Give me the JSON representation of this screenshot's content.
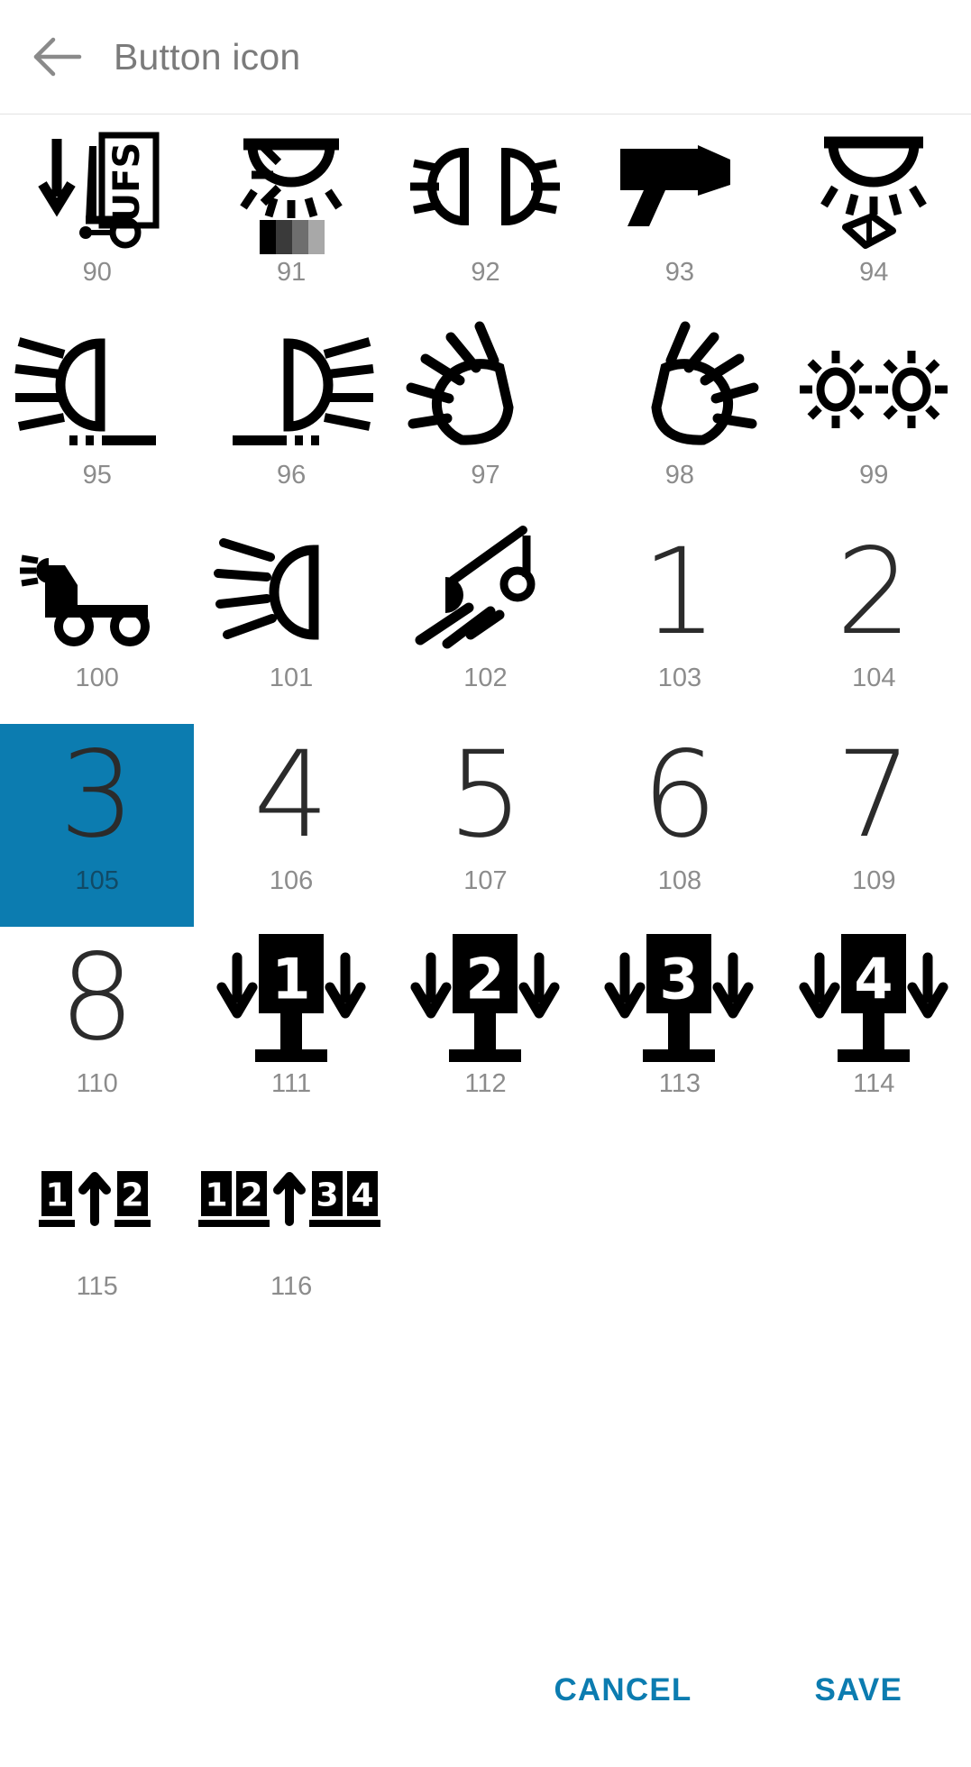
{
  "appbar": {
    "back_icon": "arrow-left-icon",
    "title": "Button icon"
  },
  "grid": {
    "columns": 5,
    "selected_label": "105",
    "selected_color": "#0C7CB0",
    "label_color": "#8c8c8c",
    "items": [
      {
        "label": "90",
        "glyph": "forklift-ufs-down-arrow",
        "kind": "symbol",
        "selected": false
      },
      {
        "label": "91",
        "glyph": "ceiling-lamp-greyscale-bar",
        "kind": "symbol",
        "selected": false
      },
      {
        "label": "92",
        "glyph": "double-headlight-beams",
        "kind": "symbol",
        "selected": false
      },
      {
        "label": "93",
        "glyph": "work-light-projector",
        "kind": "symbol",
        "selected": false
      },
      {
        "label": "94",
        "glyph": "ceiling-lamp-book",
        "kind": "symbol",
        "selected": false
      },
      {
        "label": "95",
        "glyph": "low-beam-headlight-left",
        "kind": "symbol",
        "selected": false
      },
      {
        "label": "96",
        "glyph": "low-beam-headlight-right",
        "kind": "symbol",
        "selected": false
      },
      {
        "label": "97",
        "glyph": "high-beam-headlight-left",
        "kind": "symbol",
        "selected": false
      },
      {
        "label": "98",
        "glyph": "high-beam-headlight-right",
        "kind": "symbol",
        "selected": false
      },
      {
        "label": "99",
        "glyph": "two-sun-lamps",
        "kind": "symbol",
        "selected": false
      },
      {
        "label": "100",
        "glyph": "truck-with-beam",
        "kind": "symbol",
        "selected": false
      },
      {
        "label": "101",
        "glyph": "beam-headlight-rays-left",
        "kind": "symbol",
        "selected": false
      },
      {
        "label": "102",
        "glyph": "spotlight-on-pole",
        "kind": "symbol",
        "selected": false
      },
      {
        "label": "103",
        "glyph": "digit-1",
        "kind": "digit",
        "text": "1",
        "selected": false
      },
      {
        "label": "104",
        "glyph": "digit-2",
        "kind": "digit",
        "text": "2",
        "selected": false
      },
      {
        "label": "105",
        "glyph": "digit-3",
        "kind": "digit",
        "text": "3",
        "selected": true
      },
      {
        "label": "106",
        "glyph": "digit-4",
        "kind": "digit",
        "text": "4",
        "selected": false
      },
      {
        "label": "107",
        "glyph": "digit-5",
        "kind": "digit",
        "text": "5",
        "selected": false
      },
      {
        "label": "108",
        "glyph": "digit-6",
        "kind": "digit",
        "text": "6",
        "selected": false
      },
      {
        "label": "109",
        "glyph": "digit-7",
        "kind": "digit",
        "text": "7",
        "selected": false
      },
      {
        "label": "110",
        "glyph": "digit-8",
        "kind": "digit",
        "text": "8",
        "selected": false
      },
      {
        "label": "111",
        "glyph": "mast-sign-down-arrows",
        "kind": "mast",
        "text": "1",
        "selected": false
      },
      {
        "label": "112",
        "glyph": "mast-sign-down-arrows",
        "kind": "mast",
        "text": "2",
        "selected": false
      },
      {
        "label": "113",
        "glyph": "mast-sign-down-arrows",
        "kind": "mast",
        "text": "3",
        "selected": false
      },
      {
        "label": "114",
        "glyph": "mast-sign-down-arrows",
        "kind": "mast",
        "text": "4",
        "selected": false
      },
      {
        "label": "115",
        "glyph": "boxes-up-arrow-pair",
        "kind": "boxrow",
        "text": "1|^|2",
        "selected": false
      },
      {
        "label": "116",
        "glyph": "boxes-up-arrow-quad",
        "kind": "boxrow",
        "text": "1|2|^|3|4",
        "selected": false
      }
    ]
  },
  "footer": {
    "cancel_label": "CANCEL",
    "save_label": "SAVE",
    "accent_color": "#0C7CB0"
  }
}
